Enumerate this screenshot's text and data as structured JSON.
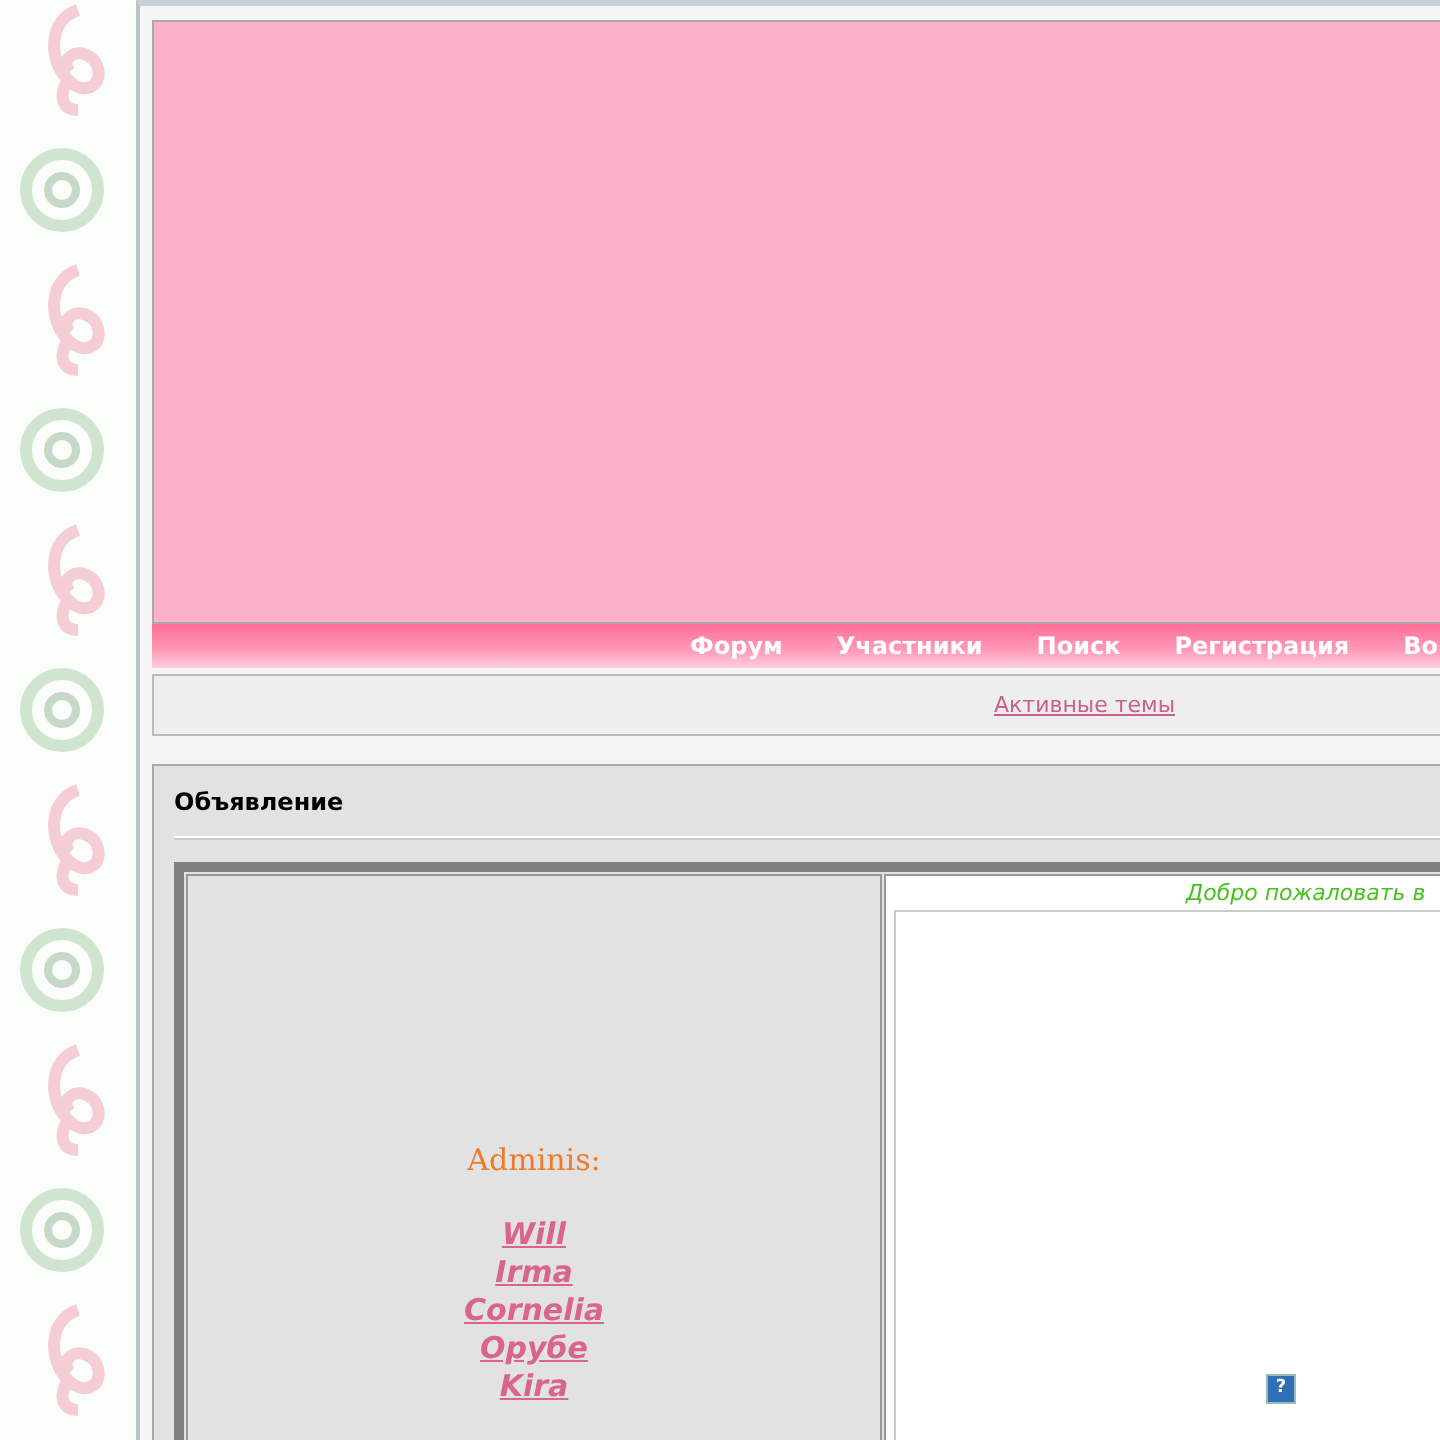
{
  "nav": {
    "items": [
      "Форум",
      "Участники",
      "Поиск",
      "Регистрация",
      "Во"
    ]
  },
  "subnav": {
    "link": "Активные темы"
  },
  "announcement": {
    "title": "Объявление",
    "admins_label": "Adminis:",
    "admins": [
      "Will",
      "Irma",
      "Cornelia",
      "Орубе",
      "Kira"
    ],
    "welcome": "Добро пожаловать в",
    "help_glyph": "?"
  }
}
